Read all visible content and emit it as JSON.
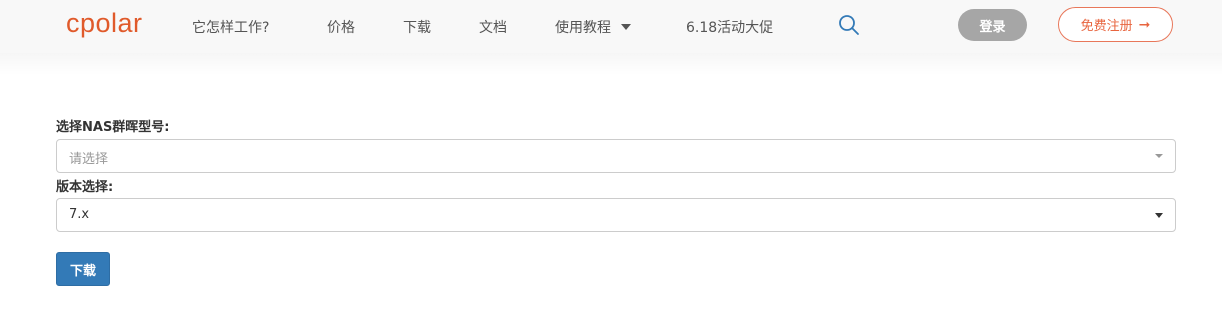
{
  "header": {
    "logo": "cpolar",
    "nav": [
      {
        "label": "它怎样工作?"
      },
      {
        "label": "价格"
      },
      {
        "label": "下载"
      },
      {
        "label": "文档"
      },
      {
        "label": "使用教程"
      },
      {
        "label": "6.18活动大促"
      }
    ],
    "login_label": "登录",
    "register_label": "免费注册",
    "register_arrow": "➞"
  },
  "form": {
    "model_label": "选择NAS群晖型号:",
    "model_placeholder": "请选择",
    "version_label": "版本选择:",
    "version_value": "7.x",
    "download_label": "下载"
  },
  "colors": {
    "brand": "#e05a2b",
    "primary_button": "#337ab7",
    "login_button": "#a6a6a6",
    "register_border": "#e8775a"
  },
  "icons": {
    "search": "search-icon",
    "dropdown": "caret-down-icon",
    "register_arrow": "arrow-right-icon"
  }
}
